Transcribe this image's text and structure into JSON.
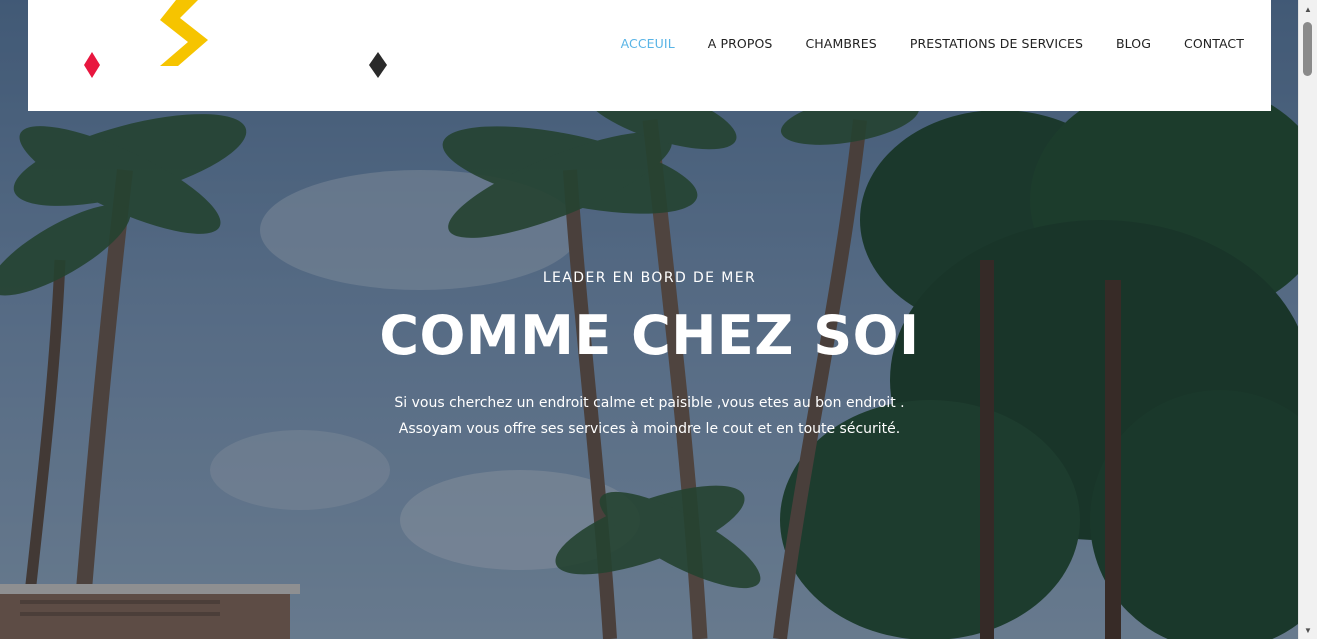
{
  "nav": {
    "items": [
      {
        "label": "ACCEUIL",
        "active": true
      },
      {
        "label": "A PROPOS",
        "active": false
      },
      {
        "label": "CHAMBRES",
        "active": false
      },
      {
        "label": "PRESTATIONS DE SERVICES",
        "active": false
      },
      {
        "label": "BLOG",
        "active": false
      },
      {
        "label": "CONTACT",
        "active": false
      }
    ]
  },
  "hero": {
    "kicker": "LEADER EN BORD DE MER",
    "title": "COMME CHEZ SOI",
    "description_line1": "Si vous cherchez un endroit calme et paisible ,vous etes au bon endroit .",
    "description_line2": "Assoyam vous offre ses services à moindre le cout et en toute sécurité."
  },
  "colors": {
    "nav_active": "#59b4e6",
    "nav_default": "#222222",
    "logo_red": "#e8173f",
    "logo_yellow": "#f6c400",
    "logo_dark": "#2a2a2a"
  },
  "icons": {
    "scroll_up": "scroll-up-arrow-icon",
    "scroll_down": "scroll-down-arrow-icon"
  }
}
